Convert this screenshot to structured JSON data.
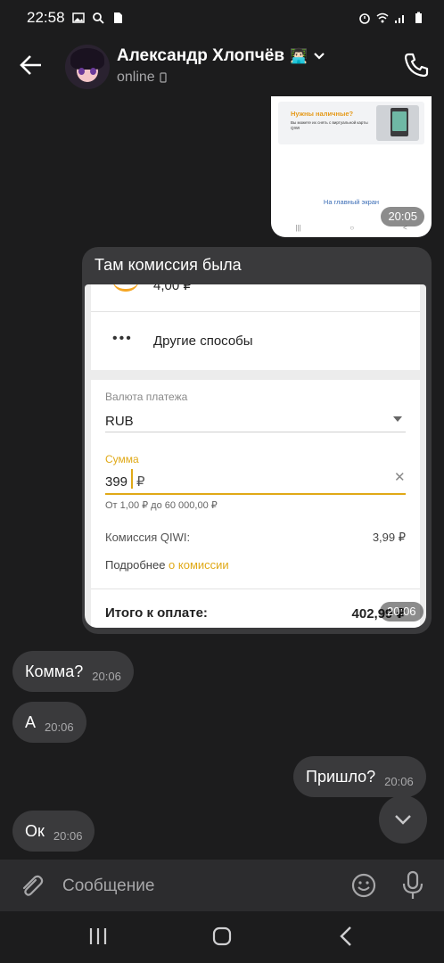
{
  "status_bar": {
    "time": "22:58"
  },
  "header": {
    "contact_name": "Александр Хлопчёв",
    "name_emoji": "👨🏻‍💻",
    "status": "online"
  },
  "image_message": {
    "banner_title": "Нужны наличные?",
    "banner_text": "Вы можете их снять с виртуальной карты QIWI",
    "home_link": "На главный экран",
    "time": "20:05"
  },
  "quote_message": {
    "text": "Там комиссия была",
    "time": "20:06",
    "screenshot": {
      "top_amount": "4,00 ₽",
      "other_methods": "Другие способы",
      "currency_label": "Валюта платежа",
      "currency_value": "RUB",
      "amount_label": "Сумма",
      "amount_value": "399",
      "amount_currency": "₽",
      "amount_hint": "От 1,00 ₽ до 60 000,00 ₽",
      "commission_label": "Комиссия QIWI:",
      "commission_value": "3,99 ₽",
      "more_prefix": "Подробнее",
      "more_link": "о комиссии",
      "total_label": "Итого к оплате:",
      "total_value": "402,99 ₽"
    }
  },
  "messages": [
    {
      "text": "Комма?",
      "time": "20:06",
      "side": "left"
    },
    {
      "text": "А",
      "time": "20:06",
      "side": "left"
    },
    {
      "text": "Пришло?",
      "time": "20:06",
      "side": "right"
    },
    {
      "text": "Ок",
      "time": "20:06",
      "side": "left"
    }
  ],
  "composer": {
    "placeholder": "Сообщение"
  },
  "colors": {
    "background": "#1c1c1d",
    "bubble": "#3a3a3c",
    "qiwi_accent": "#e0a917"
  }
}
